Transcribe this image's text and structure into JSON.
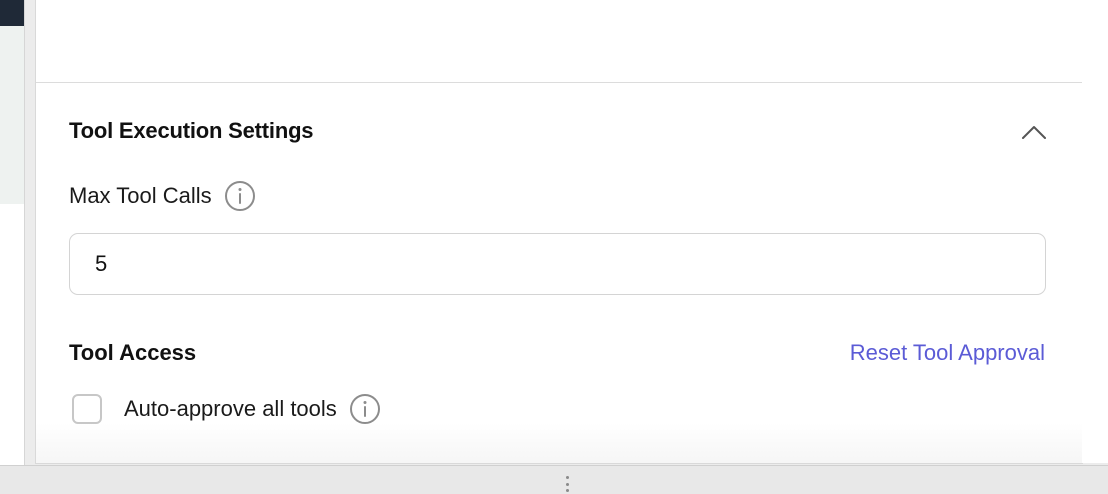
{
  "tool_execution": {
    "title": "Tool Execution Settings",
    "max_tool_calls": {
      "label": "Max Tool Calls",
      "value": "5"
    }
  },
  "tool_access": {
    "title": "Tool Access",
    "reset_label": "Reset Tool Approval",
    "auto_approve": {
      "label": "Auto-approve all tools",
      "checked": false
    }
  },
  "icons": {
    "collapse": "chevron-up-icon",
    "info": "info-icon",
    "resize": "drag-handle-icon"
  },
  "colors": {
    "accent": "#5b5bd6",
    "text": "#111111",
    "border": "#d4d4d4"
  }
}
